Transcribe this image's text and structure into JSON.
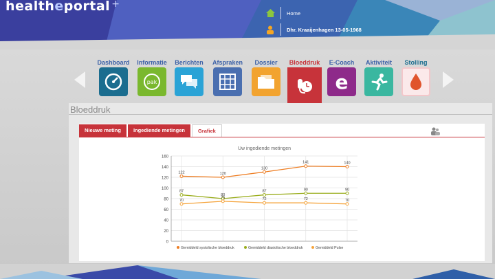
{
  "header": {
    "logo_text": "health",
    "logo_e": "e",
    "logo_rest": "portal",
    "logo_plus": "+",
    "home_label": "Home",
    "user_label": "Dhr. Kraaijenhagen 13-05-1968"
  },
  "nav": {
    "tiles": [
      {
        "label": "Dashboard",
        "icon": "gauge-icon",
        "color": "#1b6d8f"
      },
      {
        "label": "Informatie",
        "icon": "pak-icon",
        "color": "#7ab82e"
      },
      {
        "label": "Berichten",
        "icon": "chat-icon",
        "color": "#2aa3d6"
      },
      {
        "label": "Afspraken",
        "icon": "calendar-icon",
        "color": "#4a6fb0"
      },
      {
        "label": "Dossier",
        "icon": "folder-icon",
        "color": "#f2a32f"
      },
      {
        "label": "Bloeddruk",
        "icon": "blood-pressure-icon",
        "color": "#c7333a"
      },
      {
        "label": "E-Coach",
        "icon": "ecoach-icon",
        "color": "#8e2a8a"
      },
      {
        "label": "Aktiviteit",
        "icon": "runner-icon",
        "color": "#3ab7a0"
      },
      {
        "label": "Stolling",
        "icon": "drop-icon",
        "color": "#f3d0d2"
      }
    ]
  },
  "section": {
    "title": "Bloeddruk",
    "tabs": [
      "Nieuwe meting",
      "Ingediende metingen",
      "Grafiek"
    ],
    "active_tab": 2
  },
  "chart_data": {
    "type": "line",
    "title": "Uw ingediende metingen",
    "ylim": [
      0,
      160
    ],
    "yticks": [
      0,
      20,
      40,
      60,
      80,
      100,
      120,
      140,
      160
    ],
    "x": [
      1,
      2,
      3,
      4,
      5
    ],
    "grid": true,
    "legend_position": "bottom",
    "series": [
      {
        "name": "Gemiddeld systolische bloeddruk",
        "values": [
          122,
          120,
          130,
          141,
          140
        ],
        "color": "#ee7d22"
      },
      {
        "name": "Gemiddeld diastolische bloeddruk",
        "values": [
          87,
          80,
          87,
          90,
          90
        ],
        "color": "#9aad1c"
      },
      {
        "name": "Gemiddeld Pulse",
        "values": [
          70,
          75,
          72,
          72,
          70
        ],
        "color": "#f5a33a"
      }
    ]
  }
}
